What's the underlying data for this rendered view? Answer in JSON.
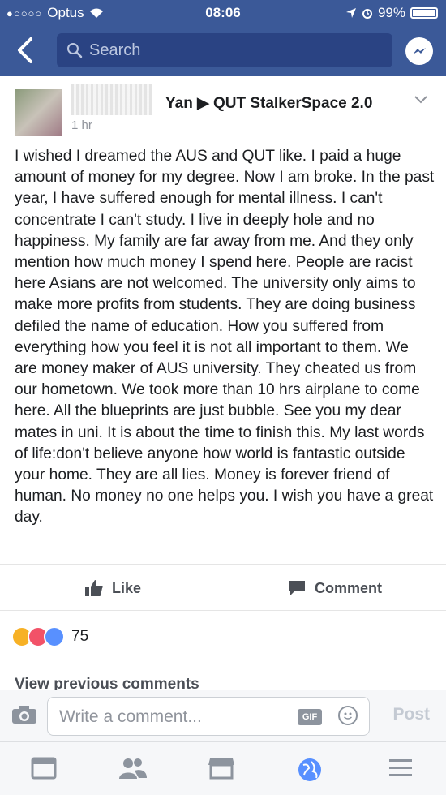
{
  "status_bar": {
    "carrier": "Optus",
    "time": "08:06",
    "battery": "99%"
  },
  "nav": {
    "search_placeholder": "Search"
  },
  "post": {
    "author_page": "Yan ▶ QUT StalkerSpace 2.0",
    "timestamp": "1 hr",
    "text": "I wished I dreamed the AUS and QUT like. I paid a huge amount of money for my degree. Now I am broke. In the past year, I have suffered enough for mental illness. I can't concentrate I can't study. I live in deeply hole and no happiness. My family are far away from me. And they only mention how much money I spend here. People are racist here Asians are not welcomed. The university only aims to make more profits from students. They are doing business defiled the name of education. How you suffered from everything how you feel it is not all important to them. We are money maker of AUS university. They cheated us from our hometown. We took more than 10 hrs airplane to come here. All the blueprints are just bubble. See you my dear mates in uni. It is about the time to finish this. My last words of life:don't believe anyone how world is fantastic outside your home. They are all lies. Money is forever friend of human. No money no one helps you. I wish you have a great day."
  },
  "actions": {
    "like_label": "Like",
    "comment_label": "Comment"
  },
  "reactions": {
    "count": "75"
  },
  "comments": {
    "view_previous": "View previous comments"
  },
  "composer": {
    "placeholder": "Write a comment...",
    "gif_label": "GIF",
    "post_label": "Post"
  },
  "colors": {
    "brand": "#3b5998",
    "search_bg": "#2a4383"
  }
}
